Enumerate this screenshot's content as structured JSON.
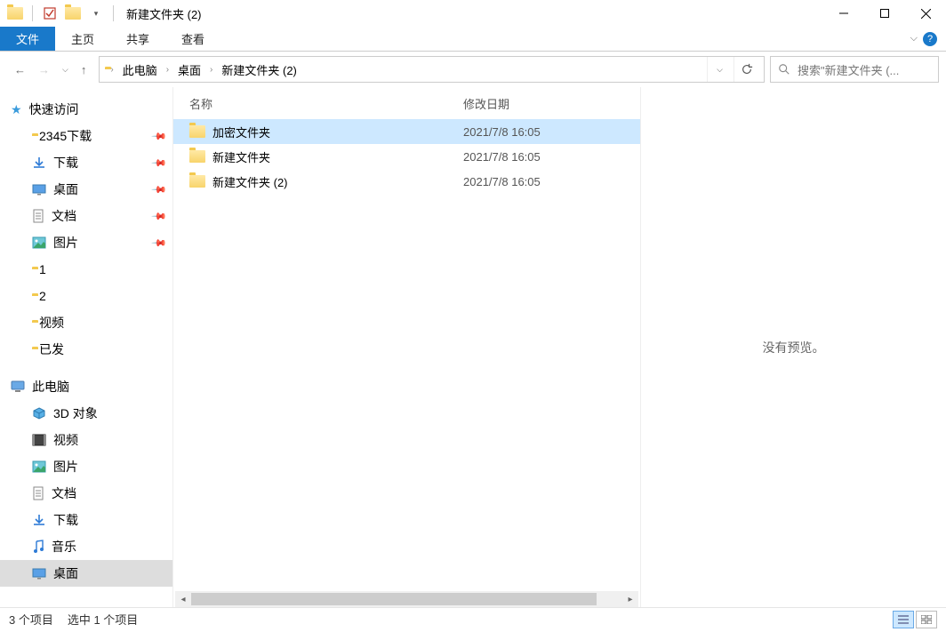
{
  "window": {
    "title": "新建文件夹 (2)"
  },
  "ribbon": {
    "file": "文件",
    "home": "主页",
    "share": "共享",
    "view": "查看"
  },
  "breadcrumbs": [
    "此电脑",
    "桌面",
    "新建文件夹 (2)"
  ],
  "search": {
    "placeholder": "搜索\"新建文件夹 (..."
  },
  "sidebar": {
    "quick": "快速访问",
    "quick_items": [
      {
        "label": "2345下载",
        "pinned": true,
        "icon": "folder"
      },
      {
        "label": "下载",
        "pinned": true,
        "icon": "download"
      },
      {
        "label": "桌面",
        "pinned": true,
        "icon": "desktop"
      },
      {
        "label": "文档",
        "pinned": true,
        "icon": "doc"
      },
      {
        "label": "图片",
        "pinned": true,
        "icon": "picture"
      },
      {
        "label": "1",
        "pinned": false,
        "icon": "folder"
      },
      {
        "label": "2",
        "pinned": false,
        "icon": "folder"
      },
      {
        "label": "视频",
        "pinned": false,
        "icon": "folder"
      },
      {
        "label": "已发",
        "pinned": false,
        "icon": "folder"
      }
    ],
    "pc": "此电脑",
    "pc_items": [
      {
        "label": "3D 对象",
        "icon": "3d"
      },
      {
        "label": "视频",
        "icon": "video"
      },
      {
        "label": "图片",
        "icon": "picture"
      },
      {
        "label": "文档",
        "icon": "doc"
      },
      {
        "label": "下载",
        "icon": "download"
      },
      {
        "label": "音乐",
        "icon": "music"
      },
      {
        "label": "桌面",
        "icon": "desktop",
        "selected": true
      }
    ]
  },
  "columns": {
    "name": "名称",
    "date": "修改日期"
  },
  "files": [
    {
      "name": "加密文件夹",
      "date": "2021/7/8 16:05",
      "selected": true
    },
    {
      "name": "新建文件夹",
      "date": "2021/7/8 16:05",
      "selected": false
    },
    {
      "name": "新建文件夹 (2)",
      "date": "2021/7/8 16:05",
      "selected": false
    }
  ],
  "preview": {
    "empty": "没有预览。"
  },
  "status": {
    "items": "3 个项目",
    "selected": "选中 1 个项目"
  }
}
